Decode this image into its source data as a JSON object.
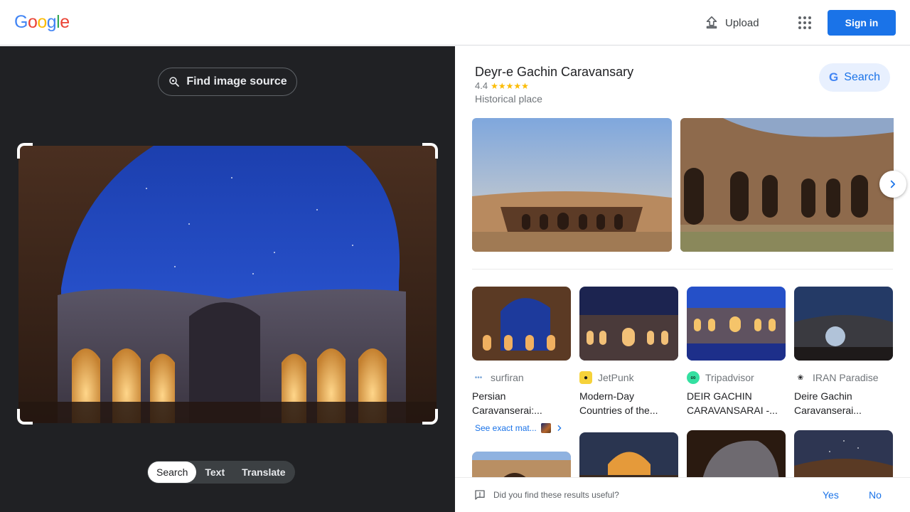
{
  "header": {
    "logo_letters": [
      "G",
      "o",
      "o",
      "g",
      "l",
      "e"
    ],
    "upload_label": "Upload",
    "signin_label": "Sign in",
    "colors": {
      "accent": "#1a73e8"
    }
  },
  "lens": {
    "find_source_label": "Find image source",
    "modes": [
      "Search",
      "Text",
      "Translate"
    ],
    "active_mode": "Search"
  },
  "place": {
    "title": "Deyr-e Gachin Caravansary",
    "rating": "4.4",
    "stars": "★★★★★",
    "type": "Historical place",
    "search_button_label": "Search",
    "search_letter": "G"
  },
  "results": [
    {
      "source": "surfiran",
      "title": "Persian Caravanserai:...",
      "favicon": "surfiran-icon"
    },
    {
      "source": "JetPunk",
      "title": "Modern-Day Countries of the...",
      "favicon": "jetpunk-icon"
    },
    {
      "source": "Tripadvisor",
      "title": "DEIR GACHIN CARAVANSARAI -...",
      "favicon": "tripadvisor-icon"
    },
    {
      "source": "IRAN Paradise",
      "title": "Deire Gachin Caravanserai...",
      "favicon": "iran-paradise-icon"
    }
  ],
  "exact_matches_label": "See exact mat...",
  "feedback": {
    "question": "Did you find these results useful?",
    "yes": "Yes",
    "no": "No"
  }
}
